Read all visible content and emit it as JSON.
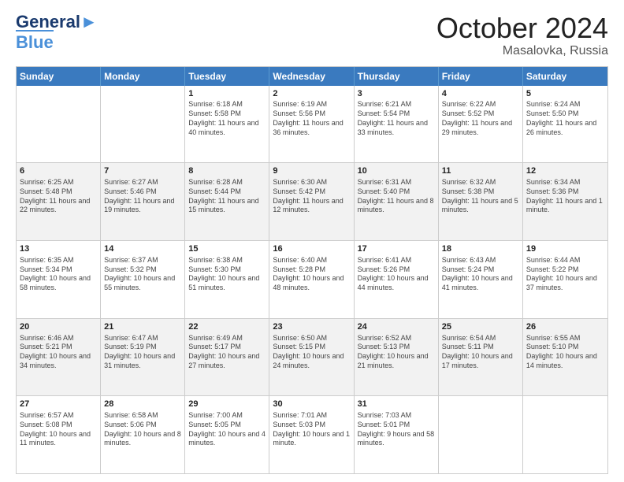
{
  "header": {
    "logo_line1": "General",
    "logo_line2": "Blue",
    "month": "October 2024",
    "location": "Masalovka, Russia"
  },
  "days_of_week": [
    "Sunday",
    "Monday",
    "Tuesday",
    "Wednesday",
    "Thursday",
    "Friday",
    "Saturday"
  ],
  "rows": [
    [
      {
        "day": "",
        "sunrise": "",
        "sunset": "",
        "daylight": ""
      },
      {
        "day": "",
        "sunrise": "",
        "sunset": "",
        "daylight": ""
      },
      {
        "day": "1",
        "sunrise": "Sunrise: 6:18 AM",
        "sunset": "Sunset: 5:58 PM",
        "daylight": "Daylight: 11 hours and 40 minutes."
      },
      {
        "day": "2",
        "sunrise": "Sunrise: 6:19 AM",
        "sunset": "Sunset: 5:56 PM",
        "daylight": "Daylight: 11 hours and 36 minutes."
      },
      {
        "day": "3",
        "sunrise": "Sunrise: 6:21 AM",
        "sunset": "Sunset: 5:54 PM",
        "daylight": "Daylight: 11 hours and 33 minutes."
      },
      {
        "day": "4",
        "sunrise": "Sunrise: 6:22 AM",
        "sunset": "Sunset: 5:52 PM",
        "daylight": "Daylight: 11 hours and 29 minutes."
      },
      {
        "day": "5",
        "sunrise": "Sunrise: 6:24 AM",
        "sunset": "Sunset: 5:50 PM",
        "daylight": "Daylight: 11 hours and 26 minutes."
      }
    ],
    [
      {
        "day": "6",
        "sunrise": "Sunrise: 6:25 AM",
        "sunset": "Sunset: 5:48 PM",
        "daylight": "Daylight: 11 hours and 22 minutes."
      },
      {
        "day": "7",
        "sunrise": "Sunrise: 6:27 AM",
        "sunset": "Sunset: 5:46 PM",
        "daylight": "Daylight: 11 hours and 19 minutes."
      },
      {
        "day": "8",
        "sunrise": "Sunrise: 6:28 AM",
        "sunset": "Sunset: 5:44 PM",
        "daylight": "Daylight: 11 hours and 15 minutes."
      },
      {
        "day": "9",
        "sunrise": "Sunrise: 6:30 AM",
        "sunset": "Sunset: 5:42 PM",
        "daylight": "Daylight: 11 hours and 12 minutes."
      },
      {
        "day": "10",
        "sunrise": "Sunrise: 6:31 AM",
        "sunset": "Sunset: 5:40 PM",
        "daylight": "Daylight: 11 hours and 8 minutes."
      },
      {
        "day": "11",
        "sunrise": "Sunrise: 6:32 AM",
        "sunset": "Sunset: 5:38 PM",
        "daylight": "Daylight: 11 hours and 5 minutes."
      },
      {
        "day": "12",
        "sunrise": "Sunrise: 6:34 AM",
        "sunset": "Sunset: 5:36 PM",
        "daylight": "Daylight: 11 hours and 1 minute."
      }
    ],
    [
      {
        "day": "13",
        "sunrise": "Sunrise: 6:35 AM",
        "sunset": "Sunset: 5:34 PM",
        "daylight": "Daylight: 10 hours and 58 minutes."
      },
      {
        "day": "14",
        "sunrise": "Sunrise: 6:37 AM",
        "sunset": "Sunset: 5:32 PM",
        "daylight": "Daylight: 10 hours and 55 minutes."
      },
      {
        "day": "15",
        "sunrise": "Sunrise: 6:38 AM",
        "sunset": "Sunset: 5:30 PM",
        "daylight": "Daylight: 10 hours and 51 minutes."
      },
      {
        "day": "16",
        "sunrise": "Sunrise: 6:40 AM",
        "sunset": "Sunset: 5:28 PM",
        "daylight": "Daylight: 10 hours and 48 minutes."
      },
      {
        "day": "17",
        "sunrise": "Sunrise: 6:41 AM",
        "sunset": "Sunset: 5:26 PM",
        "daylight": "Daylight: 10 hours and 44 minutes."
      },
      {
        "day": "18",
        "sunrise": "Sunrise: 6:43 AM",
        "sunset": "Sunset: 5:24 PM",
        "daylight": "Daylight: 10 hours and 41 minutes."
      },
      {
        "day": "19",
        "sunrise": "Sunrise: 6:44 AM",
        "sunset": "Sunset: 5:22 PM",
        "daylight": "Daylight: 10 hours and 37 minutes."
      }
    ],
    [
      {
        "day": "20",
        "sunrise": "Sunrise: 6:46 AM",
        "sunset": "Sunset: 5:21 PM",
        "daylight": "Daylight: 10 hours and 34 minutes."
      },
      {
        "day": "21",
        "sunrise": "Sunrise: 6:47 AM",
        "sunset": "Sunset: 5:19 PM",
        "daylight": "Daylight: 10 hours and 31 minutes."
      },
      {
        "day": "22",
        "sunrise": "Sunrise: 6:49 AM",
        "sunset": "Sunset: 5:17 PM",
        "daylight": "Daylight: 10 hours and 27 minutes."
      },
      {
        "day": "23",
        "sunrise": "Sunrise: 6:50 AM",
        "sunset": "Sunset: 5:15 PM",
        "daylight": "Daylight: 10 hours and 24 minutes."
      },
      {
        "day": "24",
        "sunrise": "Sunrise: 6:52 AM",
        "sunset": "Sunset: 5:13 PM",
        "daylight": "Daylight: 10 hours and 21 minutes."
      },
      {
        "day": "25",
        "sunrise": "Sunrise: 6:54 AM",
        "sunset": "Sunset: 5:11 PM",
        "daylight": "Daylight: 10 hours and 17 minutes."
      },
      {
        "day": "26",
        "sunrise": "Sunrise: 6:55 AM",
        "sunset": "Sunset: 5:10 PM",
        "daylight": "Daylight: 10 hours and 14 minutes."
      }
    ],
    [
      {
        "day": "27",
        "sunrise": "Sunrise: 6:57 AM",
        "sunset": "Sunset: 5:08 PM",
        "daylight": "Daylight: 10 hours and 11 minutes."
      },
      {
        "day": "28",
        "sunrise": "Sunrise: 6:58 AM",
        "sunset": "Sunset: 5:06 PM",
        "daylight": "Daylight: 10 hours and 8 minutes."
      },
      {
        "day": "29",
        "sunrise": "Sunrise: 7:00 AM",
        "sunset": "Sunset: 5:05 PM",
        "daylight": "Daylight: 10 hours and 4 minutes."
      },
      {
        "day": "30",
        "sunrise": "Sunrise: 7:01 AM",
        "sunset": "Sunset: 5:03 PM",
        "daylight": "Daylight: 10 hours and 1 minute."
      },
      {
        "day": "31",
        "sunrise": "Sunrise: 7:03 AM",
        "sunset": "Sunset: 5:01 PM",
        "daylight": "Daylight: 9 hours and 58 minutes."
      },
      {
        "day": "",
        "sunrise": "",
        "sunset": "",
        "daylight": ""
      },
      {
        "day": "",
        "sunrise": "",
        "sunset": "",
        "daylight": ""
      }
    ]
  ]
}
